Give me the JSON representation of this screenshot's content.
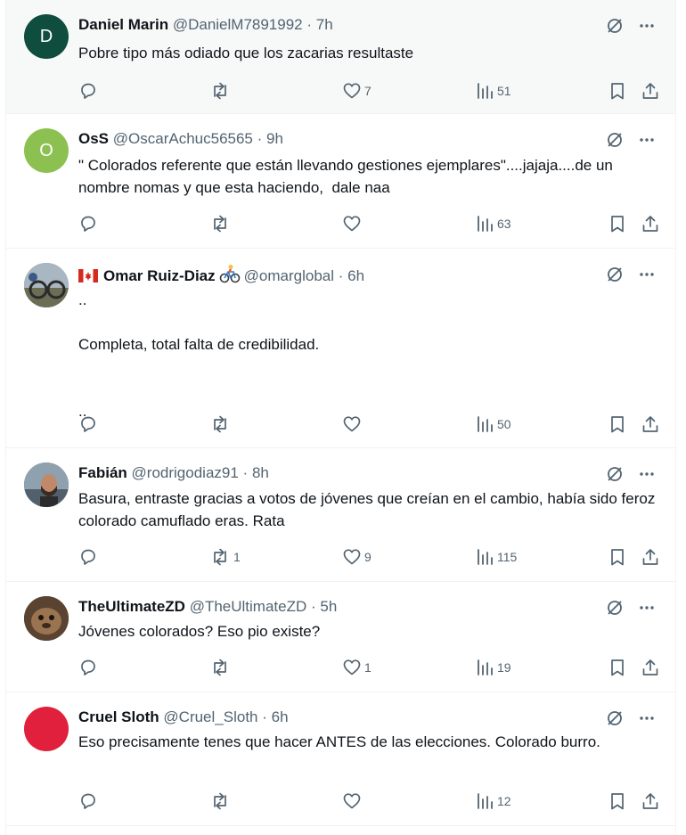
{
  "colors": {
    "text": "#0f1419",
    "muted": "#536471",
    "divider": "#eff3f4",
    "highlight": "#f7f9f9"
  },
  "tweets": [
    {
      "name": "Daniel Marin",
      "handle": "@DanielM7891992",
      "sep": "·",
      "time": "7h",
      "avatar_letter": "D",
      "avatar_color": "#0f4d3f",
      "text": "Pobre tipo más odiado que los zacarias resultaste",
      "reposts": "",
      "likes": "7",
      "views": "51"
    },
    {
      "name": "OsS",
      "handle": "@OscarAchuc56565",
      "sep": "·",
      "time": "9h",
      "avatar_letter": "O",
      "avatar_color": "#8cc152",
      "text": "\" Colorados referente que están llevando gestiones ejemplares\"....jajaja....de un nombre nomas y que esta haciendo,  dale naa",
      "reposts": "",
      "likes": "",
      "views": "63"
    },
    {
      "name": "Omar Ruiz-Diaz",
      "handle": "@omarglobal",
      "sep": "·",
      "time": "6h",
      "avatar_letter": "",
      "avatar_color": "#8a8f7a",
      "text": "..\n\nCompleta, total falta de credibilidad.\n\n\n..",
      "reposts": "",
      "likes": "",
      "views": "50"
    },
    {
      "name": "Fabián",
      "handle": "@rodrigodiaz91",
      "sep": "·",
      "time": "8h",
      "avatar_letter": "",
      "avatar_color": "#6d7d8c",
      "text": "Basura, entraste gracias a votos de jóvenes que creían en el cambio, había sido feroz colorado camuflado eras. Rata",
      "reposts": "1",
      "likes": "9",
      "views": "115"
    },
    {
      "name": "TheUltimateZD",
      "handle": "@TheUltimateZD",
      "sep": "·",
      "time": "5h",
      "avatar_letter": "",
      "avatar_color": "#7a5a3a",
      "text": "Jóvenes colorados? Eso pio existe?",
      "reposts": "",
      "likes": "1",
      "views": "19"
    },
    {
      "name": "Cruel Sloth",
      "handle": "@Cruel_Sloth",
      "sep": "·",
      "time": "6h",
      "avatar_letter": "",
      "avatar_color": "#e0203c",
      "text": "Eso precisamente tenes que hacer ANTES de las elecciones. Colorado burro.",
      "reposts": "",
      "likes": "",
      "views": "12"
    }
  ]
}
